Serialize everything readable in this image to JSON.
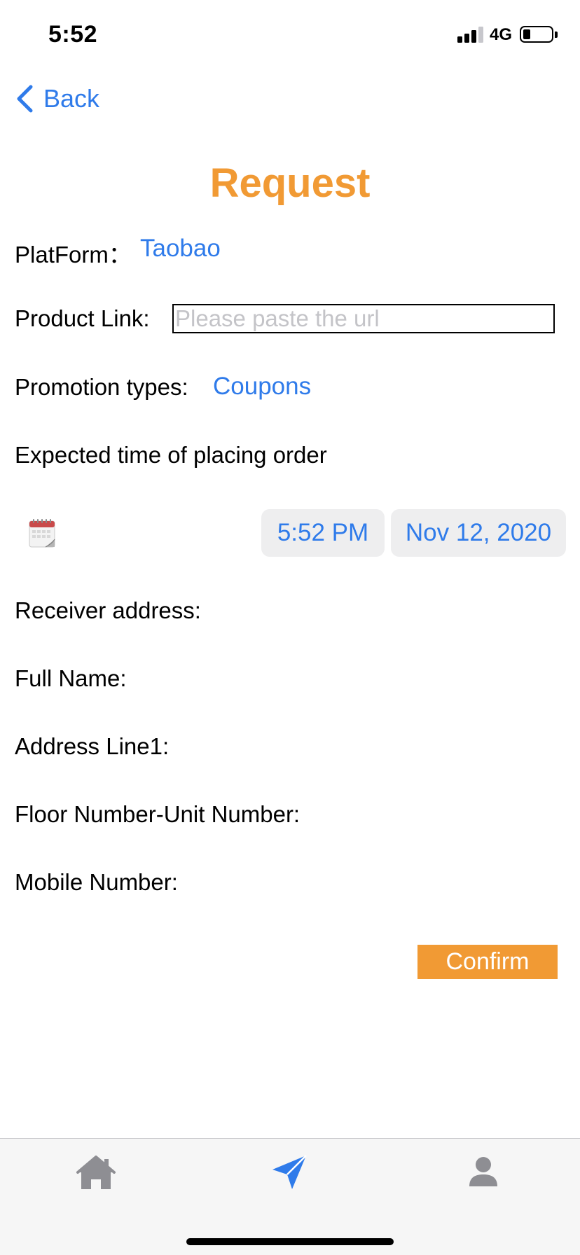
{
  "status_bar": {
    "time": "5:52",
    "network": "4G"
  },
  "nav": {
    "back_label": "Back"
  },
  "page": {
    "title": "Request"
  },
  "form": {
    "platform_label": "PlatForm：",
    "platform_value": "Taobao",
    "product_link_label": "Product Link:",
    "product_link_placeholder": "Please paste the url",
    "promotion_label": "Promotion types:",
    "promotion_value": "Coupons",
    "expected_time_label": "Expected time of placing order",
    "time_value": "5:52 PM",
    "date_value": "Nov 12, 2020",
    "receiver_address_label": "Receiver address:",
    "full_name_label": "Full Name:",
    "address_line1_label": "Address Line1:",
    "floor_unit_label": "Floor Number-Unit Number:",
    "mobile_label": "Mobile Number:",
    "confirm_label": "Confirm"
  },
  "tab_bar": {
    "tabs": [
      {
        "icon": "home-icon",
        "active": false
      },
      {
        "icon": "send-icon",
        "active": true
      },
      {
        "icon": "person-icon",
        "active": false
      }
    ]
  },
  "colors": {
    "accent_orange": "#f19a34",
    "link_blue": "#2f7bea",
    "tab_inactive": "#8e8e93"
  }
}
